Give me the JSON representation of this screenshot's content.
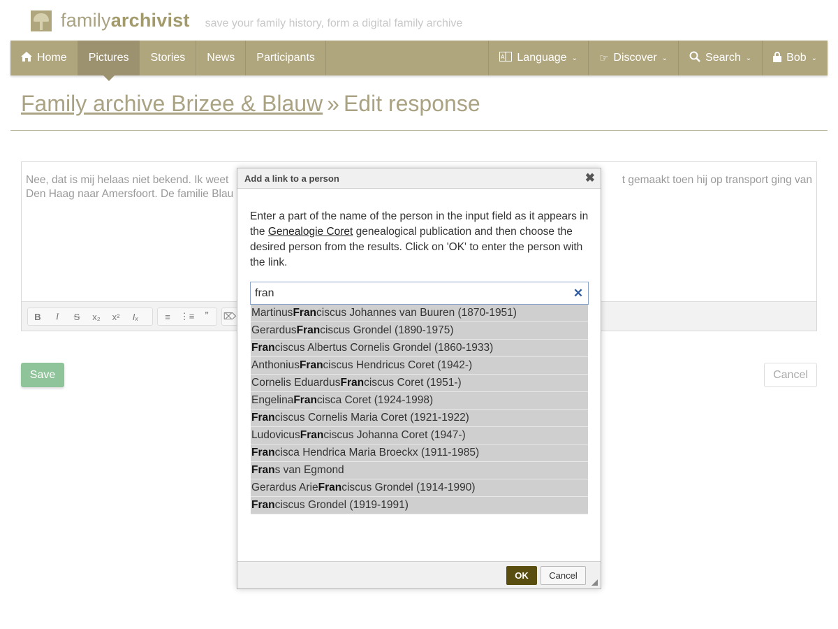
{
  "brand": {
    "name_prefix": "family",
    "name_bold": "archivist",
    "tagline": "save your family history, form a digital family archive"
  },
  "nav": {
    "left": [
      {
        "label": "Home",
        "icon": "home-icon"
      },
      {
        "label": "Pictures",
        "active": true
      },
      {
        "label": "Stories"
      },
      {
        "label": "News"
      },
      {
        "label": "Participants"
      }
    ],
    "right": [
      {
        "label": "Language",
        "icon": "language-icon"
      },
      {
        "label": "Discover",
        "icon": "hand-point-icon"
      },
      {
        "label": "Search",
        "icon": "search-icon"
      },
      {
        "label": "Bob",
        "icon": "lock-icon"
      }
    ]
  },
  "page": {
    "breadcrumb_link": "Family archive Brizee & Blauw",
    "separator": "»",
    "title": "Edit response"
  },
  "editor": {
    "text_left": "Nee, dat is mij helaas niet bekend. Ik weet",
    "text_right": "t gemaakt toen hij op transport ging van",
    "text_line2": "Den Haag naar Amersfoort. De familie Blau"
  },
  "buttons": {
    "save": "Save",
    "cancel": "Cancel"
  },
  "dialog": {
    "title": "Add a link to a person",
    "instr_before": "Enter a part of the name of the person in the input field as it appears in the ",
    "instr_link": "Genealogie Coret",
    "instr_after": " genealogical publication and then choose the desired person from the results. Click on 'OK' to enter the person with the link.",
    "search_value": "fran",
    "results": [
      {
        "pre": "Martinus ",
        "match": "Fran",
        "post": "ciscus Johannes van Buuren (1870-1951)"
      },
      {
        "pre": "Gerardus ",
        "match": "Fran",
        "post": "ciscus Grondel (1890-1975)"
      },
      {
        "pre": "",
        "match": "Fran",
        "post": "ciscus Albertus Cornelis Grondel (1860-1933)"
      },
      {
        "pre": "Anthonius ",
        "match": "Fran",
        "post": "ciscus Hendricus Coret (1942-)"
      },
      {
        "pre": "Cornelis Eduardus ",
        "match": "Fran",
        "post": "ciscus Coret (1951-)"
      },
      {
        "pre": "Engelina ",
        "match": "Fran",
        "post": "cisca Coret (1924-1998)"
      },
      {
        "pre": "",
        "match": "Fran",
        "post": "ciscus Cornelis Maria Coret (1921-1922)"
      },
      {
        "pre": "Ludovicus ",
        "match": "Fran",
        "post": "ciscus Johanna Coret (1947-)"
      },
      {
        "pre": "",
        "match": "Fran",
        "post": "cisca Hendrica Maria Broeckx (1911-1985)"
      },
      {
        "pre": "",
        "match": "Fran",
        "post": "s van Egmond"
      },
      {
        "pre": "Gerardus Arie ",
        "match": "Fran",
        "post": "ciscus Grondel (1914-1990)"
      },
      {
        "pre": "",
        "match": "Fran",
        "post": "ciscus Grondel (1919-1991)"
      }
    ],
    "ok": "OK",
    "cancel": "Cancel"
  },
  "colors": {
    "nav_bg": "#b0a67e",
    "nav_active": "#9c9270",
    "save": "#8fc49a",
    "ok": "#5a4d10"
  }
}
